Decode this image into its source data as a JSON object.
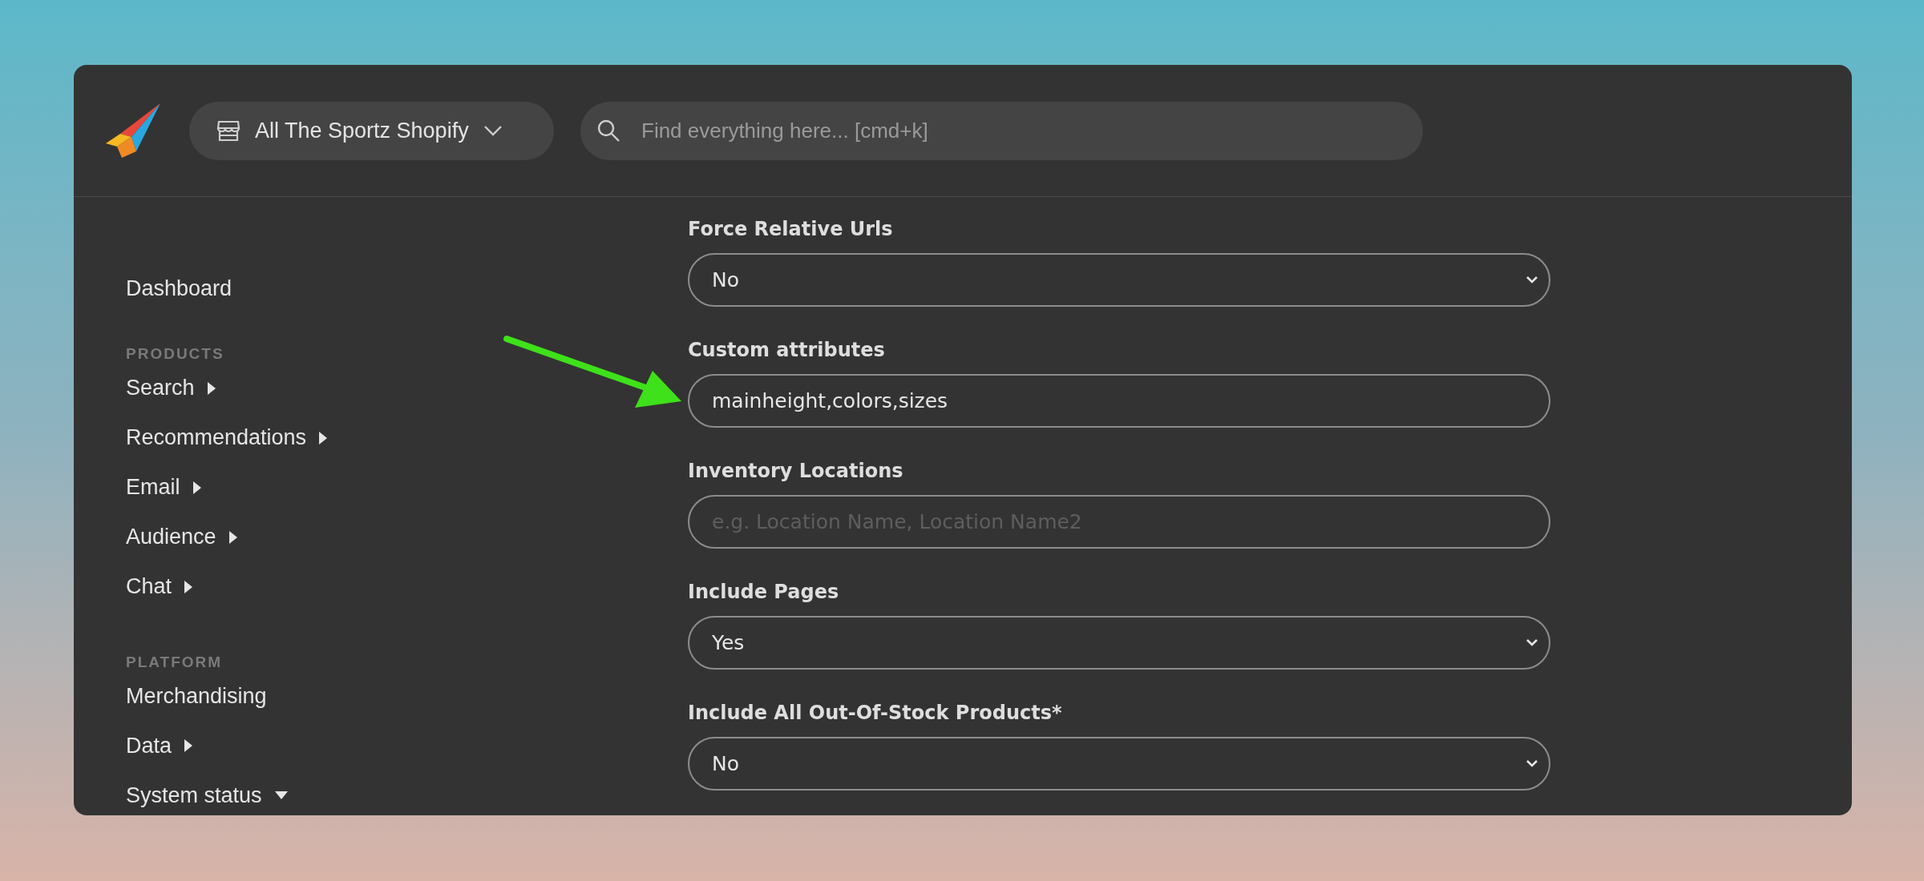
{
  "header": {
    "store_selector": "All The Sportz Shopify",
    "search": {
      "placeholder": "Find everything here... [cmd+k]"
    }
  },
  "sidebar": {
    "sections": [
      {
        "items": [
          {
            "label": "Dashboard"
          }
        ]
      },
      {
        "heading": "PRODUCTS",
        "items": [
          {
            "label": "Search",
            "expanded": false
          },
          {
            "label": "Recommendations",
            "expanded": false
          },
          {
            "label": "Email",
            "expanded": false
          },
          {
            "label": "Audience",
            "expanded": false
          },
          {
            "label": "Chat",
            "expanded": false
          }
        ]
      },
      {
        "heading": "PLATFORM",
        "items": [
          {
            "label": "Merchandising"
          },
          {
            "label": "Data",
            "expanded": false
          },
          {
            "label": "System status",
            "expanded": true
          }
        ]
      }
    ]
  },
  "form": {
    "fields": [
      {
        "label": "Force Relative Urls",
        "kind": "select",
        "value": "No"
      },
      {
        "label": "Custom attributes",
        "kind": "text",
        "value": "mainheight,colors,sizes"
      },
      {
        "label": "Inventory Locations",
        "kind": "text",
        "placeholder": "e.g. Location Name, Location Name2"
      },
      {
        "label": "Include Pages",
        "kind": "select",
        "value": "Yes"
      },
      {
        "label": "Include All Out-Of-Stock Products*",
        "kind": "select",
        "value": "No"
      }
    ]
  }
}
